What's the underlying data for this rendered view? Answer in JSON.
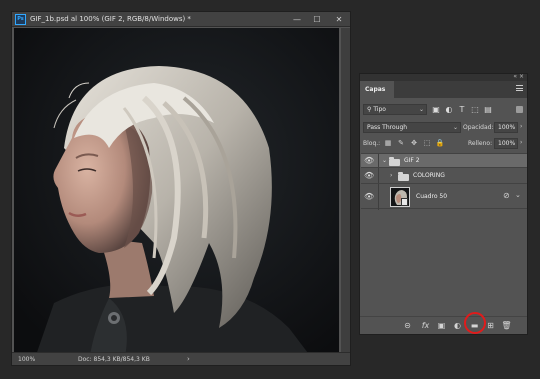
{
  "document": {
    "title": "GIF_1b.psd al 100% (GIF 2, RGB/8/Windows) *",
    "app_badge": "Ps",
    "controls": {
      "minimize": "—",
      "maximize": "☐",
      "close": "✕"
    },
    "status": {
      "zoom": "100%",
      "doc_info": "Doc: 854,3 KB/854,3 KB",
      "arrow": "›"
    }
  },
  "layers_panel": {
    "collapse": "«",
    "close": "×",
    "tab": "Capas",
    "filter": {
      "value": "Tipo",
      "search_glyph": "⚲",
      "chevron": "⌄",
      "icons": [
        "▣",
        "◐",
        "T",
        "⬚",
        "▤"
      ]
    },
    "blend_mode": {
      "value": "Pass Through",
      "chevron": "⌄"
    },
    "opacity": {
      "label": "Opacidad:",
      "value": "100%",
      "arrow": "›"
    },
    "lock": {
      "label": "Bloq.:",
      "icons": [
        "▦",
        "✎",
        "✥",
        "⬚",
        "🔒"
      ]
    },
    "fill": {
      "label": "Relleno:",
      "value": "100%",
      "arrow": "›"
    },
    "rows": [
      {
        "name": "GIF 2",
        "visible": "👁",
        "caret": "⌄"
      },
      {
        "name": "COLORING",
        "visible": "👁",
        "caret": "›"
      },
      {
        "name": "Cuadro 50",
        "visible": "👁",
        "link": "⊘",
        "fx_chevron": "⌄"
      }
    ],
    "footer_icons": [
      "⊝",
      "fx",
      "▣",
      "◐",
      "▬",
      "⊞",
      "🗑"
    ]
  },
  "colors": {
    "highlight": "#e01b1b",
    "app_accent": "#31a8ff",
    "panel_bg": "#535353",
    "workspace": "#282828"
  }
}
